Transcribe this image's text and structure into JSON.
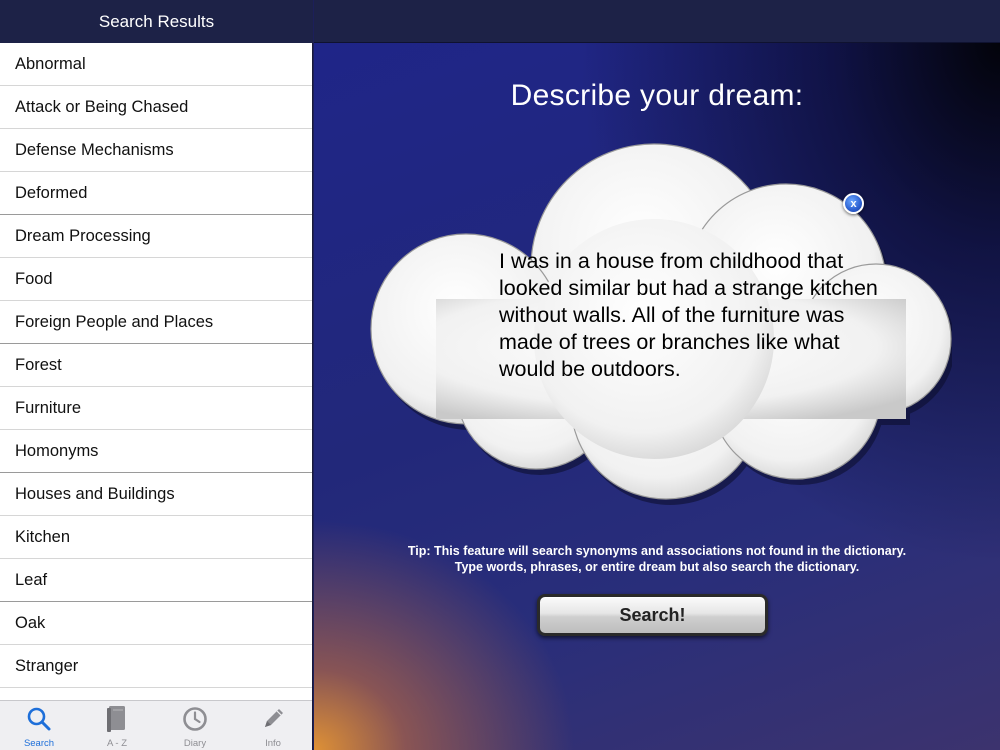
{
  "sidebar": {
    "title": "Search Results",
    "results": [
      "Abnormal",
      "Attack or Being Chased",
      "Defense Mechanisms",
      "Deformed",
      "Dream Processing",
      "Food",
      "Foreign People and Places",
      "Forest",
      "Furniture",
      "Homonyms",
      "Houses and Buildings",
      "Kitchen",
      "Leaf",
      "Oak",
      "Stranger"
    ]
  },
  "tabbar": {
    "search": "Search",
    "az": "A - Z",
    "diary": "Diary",
    "info": "Info",
    "active_color": "#1e6fd9",
    "inactive_color": "#8e8e93"
  },
  "main": {
    "prompt": "Describe your dream:",
    "dream_text": "I was in a house from childhood that looked similar but had a strange kitchen without walls. All of the furniture was made of trees or branches like what would be outdoors.",
    "clear_label": "x",
    "tip_line1": "Tip: This feature will search synonyms and associations not found in the dictionary.",
    "tip_line2": "Type words, phrases, or entire dream but also search the dictionary.",
    "search_button": "Search!"
  }
}
